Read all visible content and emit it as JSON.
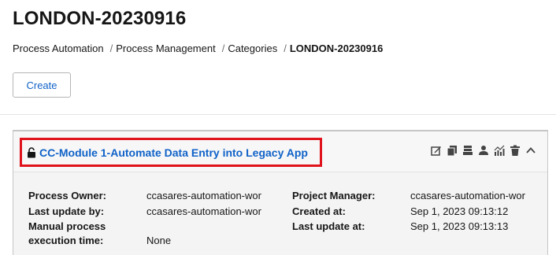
{
  "page": {
    "title": "LONDON-20230916"
  },
  "breadcrumb": [
    {
      "label": "Process Automation"
    },
    {
      "label": "Process Management"
    },
    {
      "label": "Categories"
    },
    {
      "label": "LONDON-20230916"
    }
  ],
  "breadcrumb_separator": "/",
  "toolbar": {
    "create_label": "Create"
  },
  "process": {
    "title": "CC-Module 1-Automate Data Entry into Legacy App",
    "lock_state": "unlocked",
    "actions": [
      "edit-icon",
      "copy-icon",
      "archive-icon",
      "assign-user-icon",
      "analytics-icon",
      "delete-icon",
      "collapse-icon"
    ],
    "fields_left": [
      {
        "label": "Process Owner:",
        "value": "ccasares-automation-wor"
      },
      {
        "label": "Last update by:",
        "value": "ccasares-automation-wor"
      },
      {
        "label": "Manual process",
        "value": ""
      },
      {
        "label": "execution time:",
        "value": "None"
      }
    ],
    "fields_right": [
      {
        "label": "Project Manager:",
        "value": "ccasares-automation-wor"
      },
      {
        "label": "Created at:",
        "value": "Sep 1, 2023 09:13:12"
      },
      {
        "label": "Last update at:",
        "value": "Sep 1, 2023 09:13:13"
      }
    ]
  },
  "colors": {
    "link": "#0f62c8",
    "highlight": "#e0121b",
    "text": "#161616"
  }
}
